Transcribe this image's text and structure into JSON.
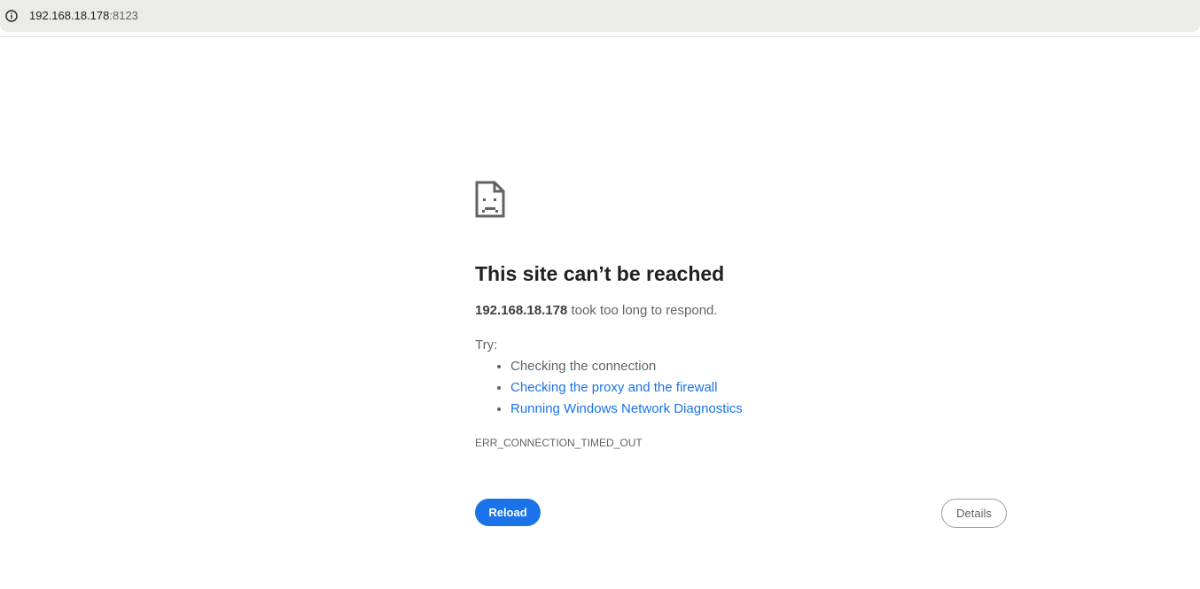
{
  "address_bar": {
    "host": "192.168.18.178",
    "port": ":8123",
    "info_icon": "info-icon"
  },
  "error": {
    "icon": "sad-page-icon",
    "title": "This site can’t be reached",
    "summary_host": "192.168.18.178",
    "summary_text": " took too long to respond.",
    "try_label": "Try:",
    "suggestions": [
      "Checking the connection",
      "Checking the proxy and the firewall",
      "Running Windows Network Diagnostics"
    ],
    "code": "ERR_CONNECTION_TIMED_OUT"
  },
  "buttons": {
    "reload_label": "Reload",
    "details_label": "Details"
  },
  "colors": {
    "accent": "#1a73e8",
    "text_primary": "#202124",
    "text_secondary": "#5f6368",
    "address_bar_bg": "#ebebe7"
  }
}
